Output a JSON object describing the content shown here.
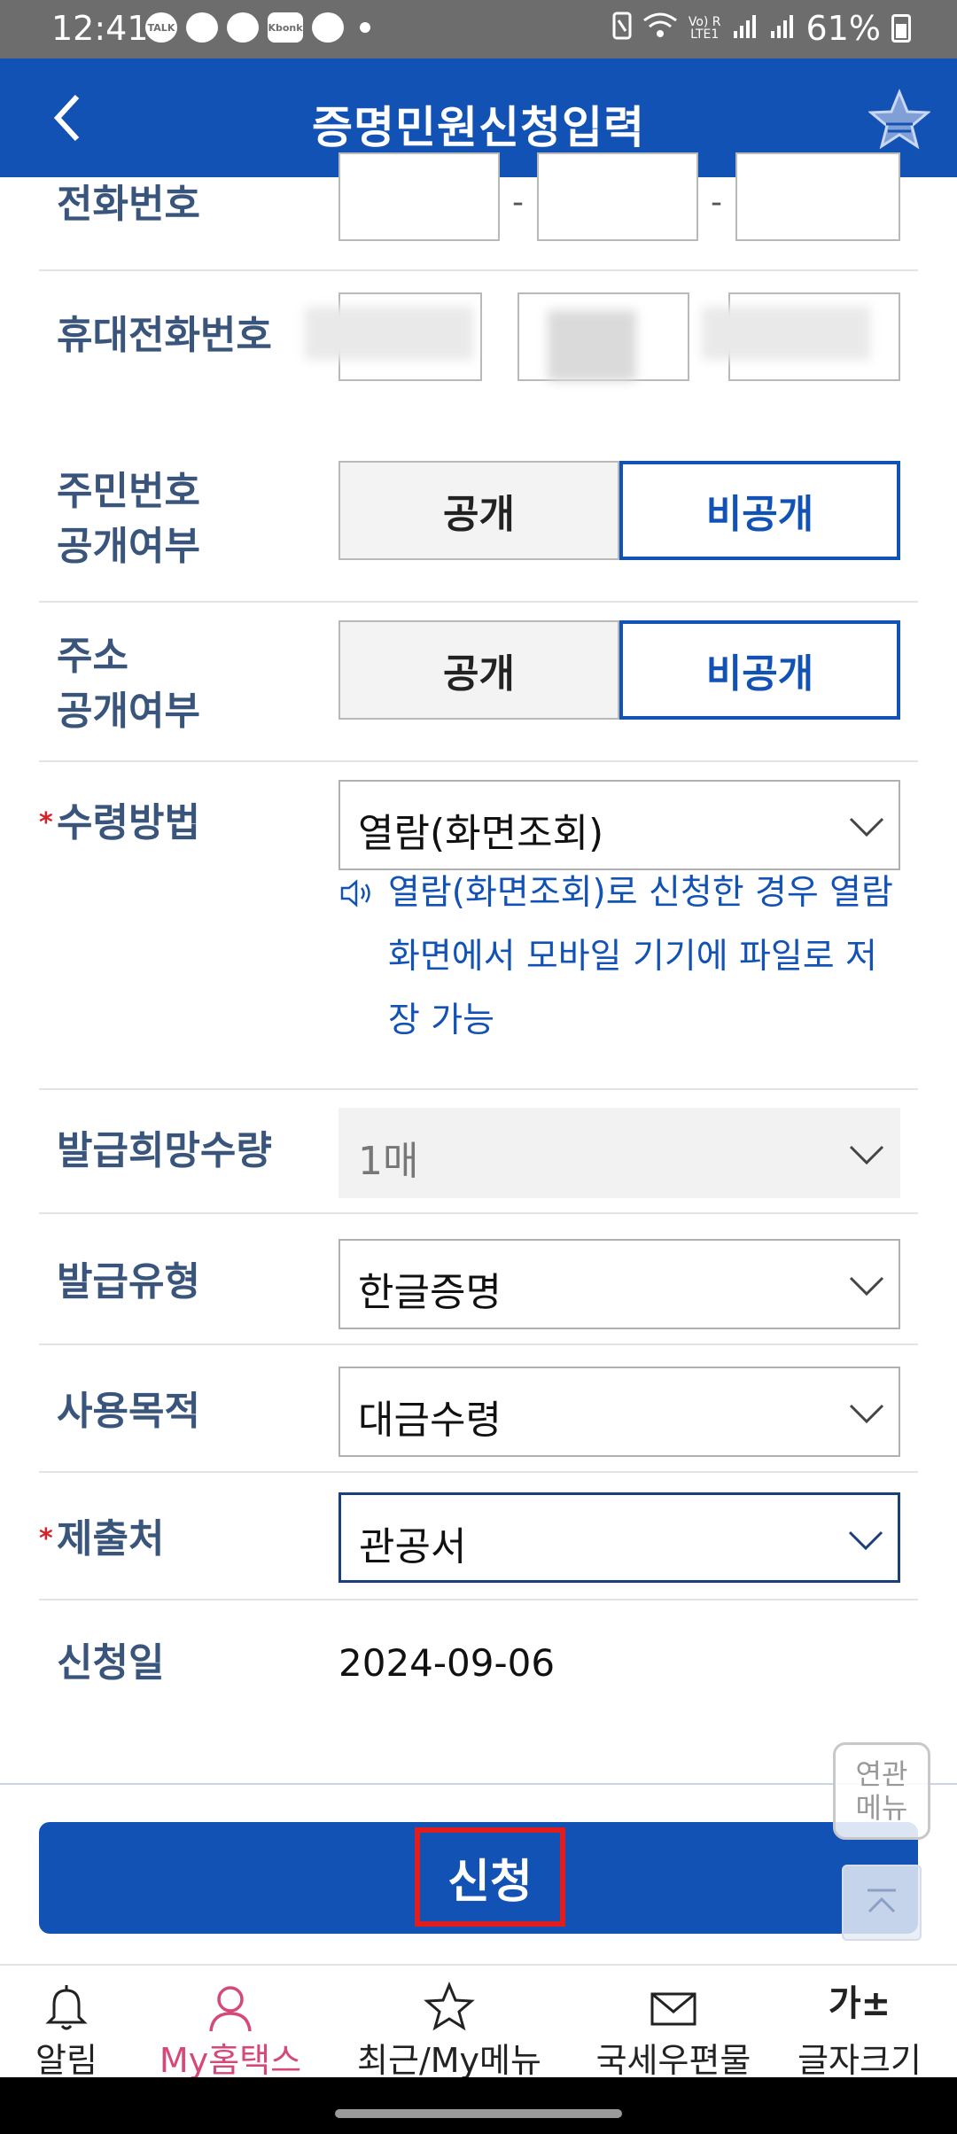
{
  "status_bar": {
    "time": "12:41",
    "apps": [
      "TALK",
      "",
      "",
      "Kbonk",
      ""
    ],
    "network_top": "Vo) R",
    "network_bottom": "LTE1",
    "battery": "61%"
  },
  "header": {
    "title": "증명민원신청입력",
    "back_icon": "chevron-left-icon",
    "favorite_icon": "star-icon"
  },
  "form": {
    "phone": {
      "label": "전화번호",
      "sep1": "-",
      "sep2": "-"
    },
    "mobile": {
      "label": "휴대전화번호"
    },
    "rrn_public": {
      "label_line1": "주민번호",
      "label_line2": "공개여부",
      "opt_public": "공개",
      "opt_private": "비공개",
      "selected": "비공개"
    },
    "addr_public": {
      "label_line1": "주소",
      "label_line2": "공개여부",
      "opt_public": "공개",
      "opt_private": "비공개",
      "selected": "비공개"
    },
    "receive_method": {
      "required_mark": "*",
      "label": "수령방법",
      "value": "열람(화면조회)",
      "note": "열람(화면조회)로 신청한 경우 열람화면에서 모바일 기기에 파일로 저장 가능"
    },
    "issue_quantity": {
      "label": "발급희망수량",
      "value": "1매"
    },
    "issue_type": {
      "label": "발급유형",
      "value": "한글증명"
    },
    "purpose": {
      "label": "사용목적",
      "value": "대금수령"
    },
    "submit_to": {
      "required_mark": "*",
      "label": "제출처",
      "value": "관공서"
    },
    "apply_date": {
      "label": "신청일",
      "value": "2024-09-06"
    }
  },
  "related_menu": {
    "line1": "연관",
    "line2": "메뉴"
  },
  "submit_button": {
    "label": "신청"
  },
  "tabbar": {
    "items": [
      {
        "label": "알림",
        "icon": "bell-icon"
      },
      {
        "label": "My홈택스",
        "icon": "person-icon",
        "active": true
      },
      {
        "label": "최근/My메뉴",
        "icon": "star-outline-icon"
      },
      {
        "label": "국세우편물",
        "icon": "mail-icon"
      },
      {
        "label": "글자크기",
        "icon": "font-size-icon",
        "icon_text": "가±"
      }
    ]
  },
  "colors": {
    "primary": "#1352b5",
    "label": "#3a557c",
    "required": "#d8222a",
    "highlight": "#e11d1d",
    "active_tab": "#d6487a"
  }
}
